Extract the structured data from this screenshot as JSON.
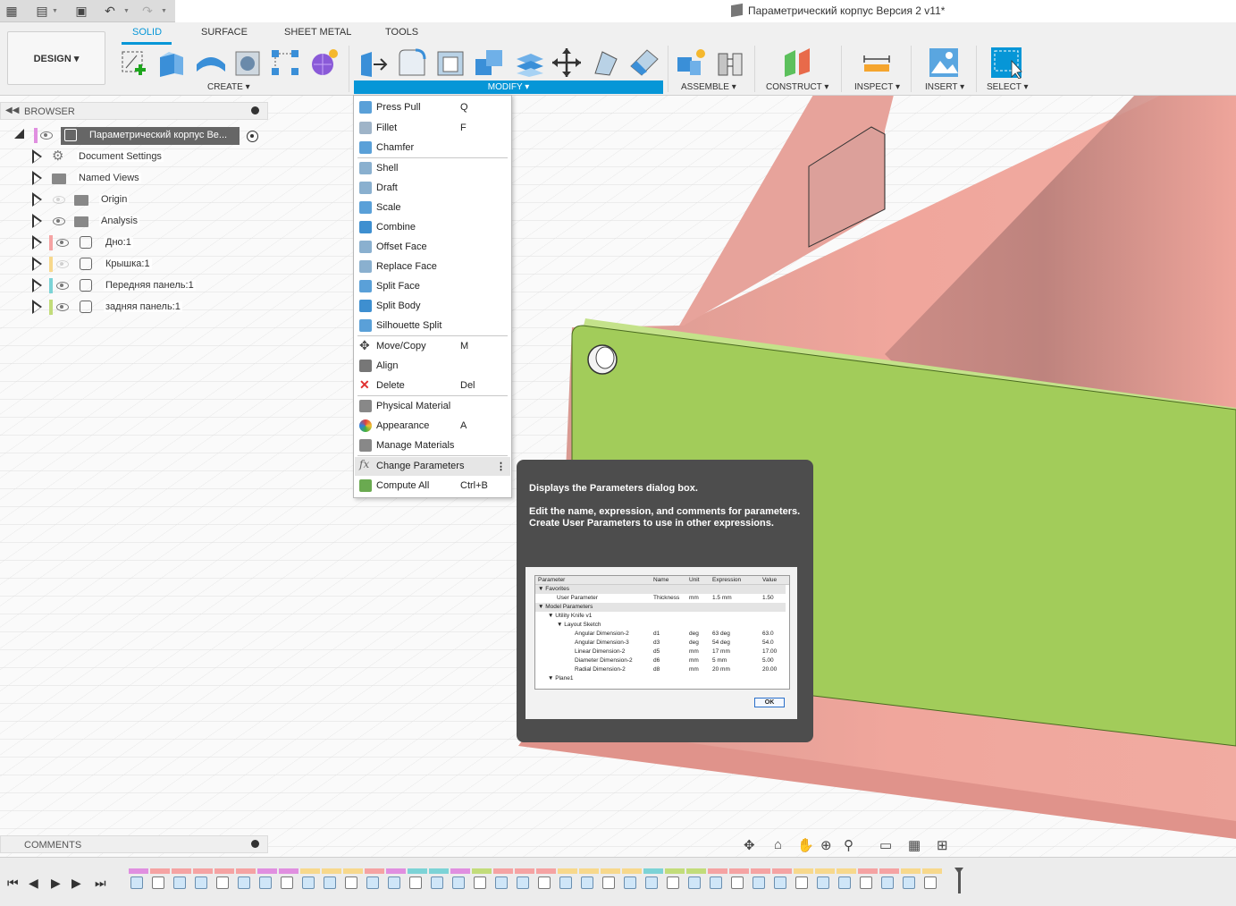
{
  "window": {
    "title": "Параметрический корпус Версия 2 v11*"
  },
  "workspace": {
    "label": "DESIGN ▾"
  },
  "tabs": [
    "SOLID",
    "SURFACE",
    "SHEET METAL",
    "TOOLS"
  ],
  "ribbon_groups": {
    "create": "CREATE ▾",
    "modify": "MODIFY ▾",
    "assemble": "ASSEMBLE ▾",
    "construct": "CONSTRUCT ▾",
    "inspect": "INSPECT ▾",
    "insert": "INSERT ▾",
    "select": "SELECT ▾"
  },
  "browser": {
    "title": "BROWSER",
    "root": "Параметрический корпус Ве...",
    "items": [
      {
        "label": "Document Settings",
        "kind": "settings"
      },
      {
        "label": "Named Views",
        "kind": "folder"
      },
      {
        "label": "Origin",
        "kind": "folder",
        "hidden": true
      },
      {
        "label": "Analysis",
        "kind": "folder"
      },
      {
        "label": "Дно:1",
        "kind": "body",
        "color": "#f5a3a3"
      },
      {
        "label": "Крышка:1",
        "kind": "body",
        "color": "#f7d88c",
        "hidden": true
      },
      {
        "label": "Передняя панель:1",
        "kind": "body",
        "color": "#7cd3d6"
      },
      {
        "label": "задняя панель:1",
        "kind": "body",
        "color": "#c2dc7a"
      }
    ]
  },
  "modify_menu": [
    {
      "label": "Press Pull",
      "key": "Q",
      "icon": "press-pull-icon",
      "color": "#5aa0d8"
    },
    {
      "label": "Fillet",
      "key": "F",
      "icon": "fillet-icon",
      "color": "#9fb4c8"
    },
    {
      "label": "Chamfer",
      "key": "",
      "icon": "chamfer-icon",
      "color": "#5aa0d8"
    },
    {
      "label": "Shell",
      "key": "",
      "icon": "shell-icon",
      "color": "#8ab0cf"
    },
    {
      "label": "Draft",
      "key": "",
      "icon": "draft-icon",
      "color": "#8ab0cf"
    },
    {
      "label": "Scale",
      "key": "",
      "icon": "scale-icon",
      "color": "#5aa0d8"
    },
    {
      "label": "Combine",
      "key": "",
      "icon": "combine-icon",
      "color": "#3e8fd0"
    },
    {
      "label": "Offset Face",
      "key": "",
      "icon": "offset-face-icon",
      "color": "#8ab0cf"
    },
    {
      "label": "Replace Face",
      "key": "",
      "icon": "replace-face-icon",
      "color": "#8ab0cf"
    },
    {
      "label": "Split Face",
      "key": "",
      "icon": "split-face-icon",
      "color": "#5aa0d8"
    },
    {
      "label": "Split Body",
      "key": "",
      "icon": "split-body-icon",
      "color": "#3e8fd0"
    },
    {
      "label": "Silhouette Split",
      "key": "",
      "icon": "silhouette-split-icon",
      "color": "#5aa0d8"
    },
    {
      "label": "Move/Copy",
      "key": "M",
      "icon": "move-icon",
      "color": "#555555"
    },
    {
      "label": "Align",
      "key": "",
      "icon": "align-icon",
      "color": "#777777"
    },
    {
      "label": "Delete",
      "key": "Del",
      "icon": "delete-icon",
      "color": "#e03030"
    },
    {
      "label": "Physical Material",
      "key": "",
      "icon": "physical-material-icon",
      "color": "#888888"
    },
    {
      "label": "Appearance",
      "key": "A",
      "icon": "appearance-icon",
      "color": "#d89030"
    },
    {
      "label": "Manage Materials",
      "key": "",
      "icon": "manage-materials-icon",
      "color": "#888888"
    },
    {
      "label": "Change Parameters",
      "key": "⋮",
      "icon": "fx-icon",
      "color": "#666666"
    },
    {
      "label": "Compute All",
      "key": "Ctrl+B",
      "icon": "compute-all-icon",
      "color": "#6aaa50"
    }
  ],
  "tooltip": {
    "title": "Displays the Parameters dialog box.",
    "body": "Edit the name, expression, and comments for parameters. Create User Parameters to use in other expressions.",
    "table": {
      "headers": [
        "Parameter",
        "Name",
        "Unit",
        "Expression",
        "Value"
      ],
      "rows": [
        {
          "p": "▼ Favorites",
          "n": "",
          "u": "",
          "e": "",
          "v": "",
          "group": true
        },
        {
          "p": "User Parameter",
          "n": "Thickness",
          "u": "mm",
          "e": "1.5 mm",
          "v": "1.50"
        },
        {
          "p": "▼ Model Parameters",
          "n": "",
          "u": "",
          "e": "",
          "v": "",
          "group": true
        },
        {
          "p": "▼ Utility Knife v1",
          "n": "",
          "u": "",
          "e": "",
          "v": ""
        },
        {
          "p": "▼ Layout Sketch",
          "n": "",
          "u": "",
          "e": "",
          "v": ""
        },
        {
          "p": "Angular Dimension-2",
          "n": "d1",
          "u": "deg",
          "e": "63 deg",
          "v": "63.0"
        },
        {
          "p": "Angular Dimension-3",
          "n": "d3",
          "u": "deg",
          "e": "54 deg",
          "v": "54.0"
        },
        {
          "p": "Linear Dimension-2",
          "n": "d5",
          "u": "mm",
          "e": "17 mm",
          "v": "17.00"
        },
        {
          "p": "Diameter Dimension-2",
          "n": "d6",
          "u": "mm",
          "e": "5 mm",
          "v": "5.00"
        },
        {
          "p": "Radial Dimension-2",
          "n": "d8",
          "u": "mm",
          "e": "20 mm",
          "v": "20.00"
        },
        {
          "p": "▼ Plane1",
          "n": "",
          "u": "",
          "e": "",
          "v": ""
        }
      ],
      "ok": "OK"
    }
  },
  "comments": {
    "title": "COMMENTS"
  },
  "colors": {
    "accent": "#0696d7",
    "green_panel": "#a2cc5a",
    "pink_body": "#efa59c"
  }
}
